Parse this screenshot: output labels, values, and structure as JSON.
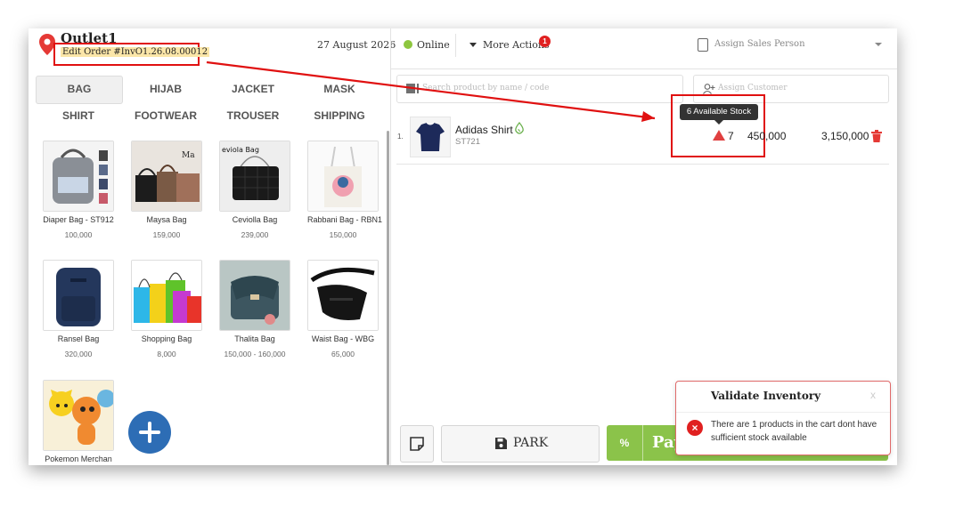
{
  "header": {
    "outlet_name": "Outlet1",
    "order_label": "Edit Order #InvO1.26.08.00012",
    "date": "27 August 2026",
    "status": "Online",
    "more_actions": "More Actions",
    "more_actions_badge": "1",
    "assign_sales": "Assign Sales Person"
  },
  "categories": [
    "BAG",
    "HIJAB",
    "JACKET",
    "MASK",
    "SHIRT",
    "FOOTWEAR",
    "TROUSER",
    "SHIPPING"
  ],
  "active_category": "BAG",
  "products": [
    {
      "name": "Diaper Bag - ST912",
      "price": "100,000"
    },
    {
      "name": "Maysa Bag",
      "price": "159,000"
    },
    {
      "name": "Ceviolla Bag",
      "price": "239,000"
    },
    {
      "name": "Rabbani Bag - RBN1",
      "price": "150,000"
    },
    {
      "name": "Ransel Bag",
      "price": "320,000"
    },
    {
      "name": "Shopping Bag",
      "price": "8,000"
    },
    {
      "name": "Thalita Bag",
      "price": "150,000 - 160,000"
    },
    {
      "name": "Waist Bag - WBG",
      "price": "65,000"
    },
    {
      "name": "Pokemon Merchan",
      "price": ""
    }
  ],
  "search": {
    "placeholder": "Search product by name / code"
  },
  "customer": {
    "placeholder": "Assign Customer"
  },
  "cart": [
    {
      "no": "1.",
      "name": "Adidas Shirt",
      "code": "ST721",
      "qty": "7",
      "price": "450,000",
      "total": "3,150,000",
      "stock_tooltip": "6 Available Stock"
    }
  ],
  "bottom": {
    "park_label": "PARK",
    "discount_label": "%",
    "pay_label": "Pay"
  },
  "toast": {
    "title": "Validate Inventory",
    "close": "x",
    "message": "There are 1 products in the cart dont have sufficient stock available"
  },
  "colors": {
    "accent_green": "#8bc34a",
    "danger_red": "#e02020",
    "fab_blue": "#2d6db5"
  }
}
